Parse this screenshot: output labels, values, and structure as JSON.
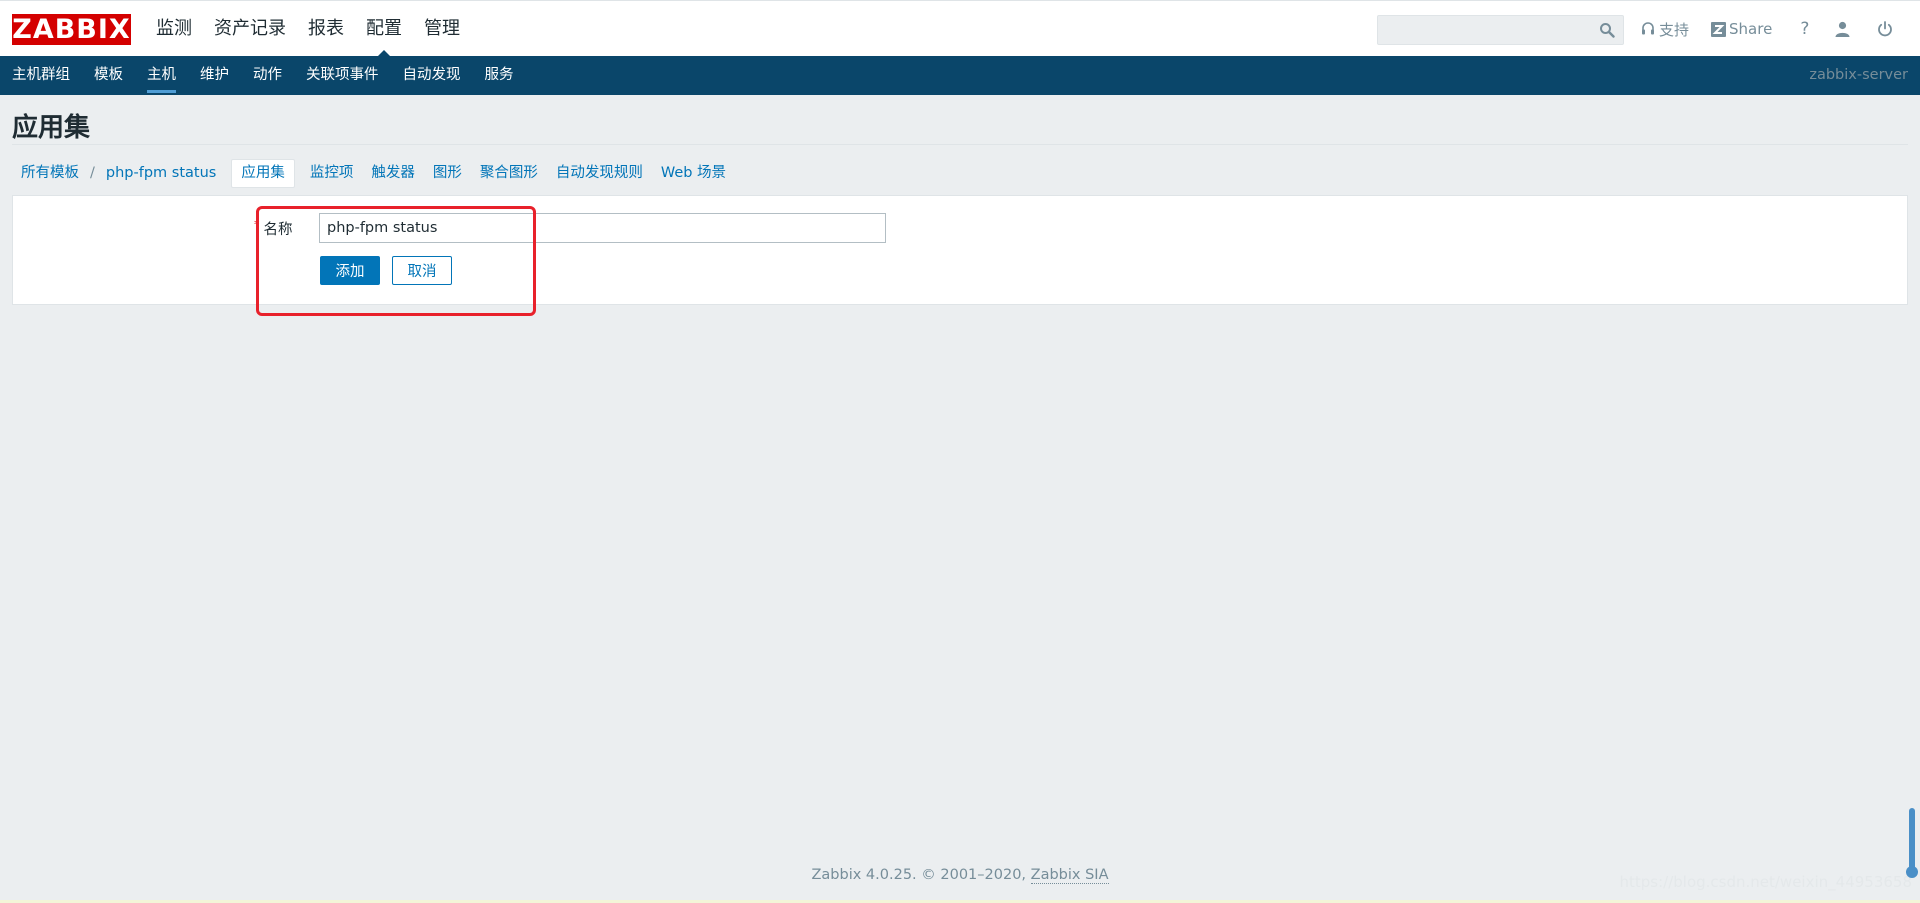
{
  "app": {
    "logo": "ZABBIX"
  },
  "top_menu": [
    {
      "label": "监测",
      "active": false
    },
    {
      "label": "资产记录",
      "active": false
    },
    {
      "label": "报表",
      "active": false
    },
    {
      "label": "配置",
      "active": true
    },
    {
      "label": "管理",
      "active": false
    }
  ],
  "search": {
    "placeholder": "",
    "icon": "search-icon"
  },
  "top_links": {
    "support": "支持",
    "share": "Share",
    "help": "?"
  },
  "sub_menu": [
    {
      "label": "主机群组",
      "active": false
    },
    {
      "label": "模板",
      "active": false
    },
    {
      "label": "主机",
      "active": true
    },
    {
      "label": "维护",
      "active": false
    },
    {
      "label": "动作",
      "active": false
    },
    {
      "label": "关联项事件",
      "active": false
    },
    {
      "label": "自动发现",
      "active": false
    },
    {
      "label": "服务",
      "active": false
    }
  ],
  "server_name": "zabbix-server",
  "page_title": "应用集",
  "breadcrumbs": [
    {
      "label": "所有模板"
    },
    {
      "label": "/"
    },
    {
      "label": "php-fpm status"
    },
    {
      "label": "应用集",
      "current": true
    },
    {
      "label": "监控项"
    },
    {
      "label": "触发器"
    },
    {
      "label": "图形"
    },
    {
      "label": "聚合图形"
    },
    {
      "label": "自动发现规则"
    },
    {
      "label": "Web 场景"
    }
  ],
  "form": {
    "required_mark": "*",
    "name_label": "名称",
    "name_value": "php-fpm status",
    "add_button": "添加",
    "cancel_button": "取消"
  },
  "footer": {
    "text": "Zabbix 4.0.25. © 2001–2020,",
    "link": "Zabbix SIA"
  },
  "watermark": "https://blog.csdn.net/weixin_44953658",
  "colors": {
    "brand_red": "#d40000",
    "nav_blue": "#0a466a",
    "link_blue": "#0275b8",
    "highlight_red": "#e8212b"
  }
}
